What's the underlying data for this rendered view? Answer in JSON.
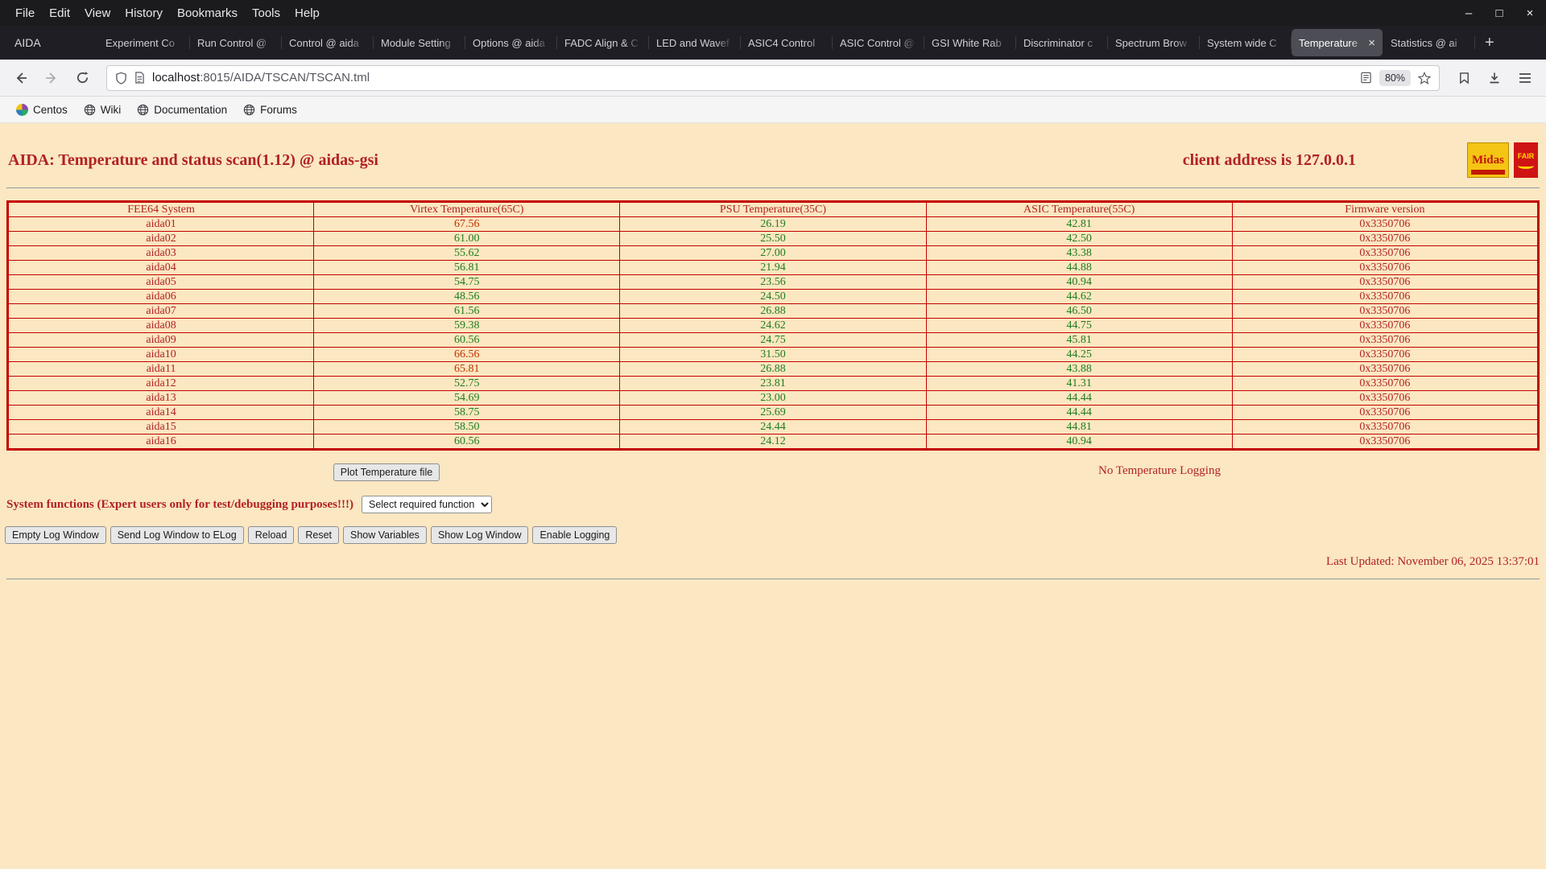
{
  "window": {
    "menu_items": [
      "File",
      "Edit",
      "View",
      "History",
      "Bookmarks",
      "Tools",
      "Help"
    ]
  },
  "tabs": {
    "app_label": "AIDA",
    "items": [
      {
        "label": "Experiment Co"
      },
      {
        "label": "Run Control @"
      },
      {
        "label": "Control @ aida"
      },
      {
        "label": "Module Setting"
      },
      {
        "label": "Options @ aida"
      },
      {
        "label": "FADC Align & C"
      },
      {
        "label": "LED and Wavef"
      },
      {
        "label": "ASIC4 Control"
      },
      {
        "label": "ASIC Control @"
      },
      {
        "label": "GSI White Rab"
      },
      {
        "label": "Discriminator c"
      },
      {
        "label": "Spectrum Brow"
      },
      {
        "label": "System wide C"
      },
      {
        "label": "Temperature",
        "active": true
      },
      {
        "label": "Statistics @ ai"
      }
    ]
  },
  "navbar": {
    "url_host": "localhost",
    "url_rest": ":8015/AIDA/TSCAN/TSCAN.tml",
    "zoom": "80%"
  },
  "bookmarks": [
    {
      "label": "Centos",
      "icon": "centos"
    },
    {
      "label": "Wiki",
      "icon": "globe"
    },
    {
      "label": "Documentation",
      "icon": "globe"
    },
    {
      "label": "Forums",
      "icon": "globe"
    }
  ],
  "page": {
    "title": "AIDA: Temperature and status scan(1.12) @ aidas-gsi",
    "client_address": "client address is 127.0.0.1",
    "logos": [
      {
        "name": "midas-logo",
        "text": "Midas"
      },
      {
        "name": "fair-logo",
        "text": "FAIR"
      }
    ],
    "table": {
      "headers": [
        "FEE64 System",
        "Virtex Temperature(65C)",
        "PSU Temperature(35C)",
        "ASIC Temperature(55C)",
        "Firmware version"
      ],
      "rows": [
        {
          "name": "aida01",
          "virtex": "67.56",
          "virtex_alarm": true,
          "psu": "26.19",
          "asic": "42.81",
          "fw": "0x3350706"
        },
        {
          "name": "aida02",
          "virtex": "61.00",
          "psu": "25.50",
          "asic": "42.50",
          "fw": "0x3350706"
        },
        {
          "name": "aida03",
          "virtex": "55.62",
          "psu": "27.00",
          "asic": "43.38",
          "fw": "0x3350706"
        },
        {
          "name": "aida04",
          "virtex": "56.81",
          "psu": "21.94",
          "asic": "44.88",
          "fw": "0x3350706"
        },
        {
          "name": "aida05",
          "virtex": "54.75",
          "psu": "23.56",
          "asic": "40.94",
          "fw": "0x3350706"
        },
        {
          "name": "aida06",
          "virtex": "48.56",
          "psu": "24.50",
          "asic": "44.62",
          "fw": "0x3350706"
        },
        {
          "name": "aida07",
          "virtex": "61.56",
          "psu": "26.88",
          "asic": "46.50",
          "fw": "0x3350706"
        },
        {
          "name": "aida08",
          "virtex": "59.38",
          "psu": "24.62",
          "asic": "44.75",
          "fw": "0x3350706"
        },
        {
          "name": "aida09",
          "virtex": "60.56",
          "psu": "24.75",
          "asic": "45.81",
          "fw": "0x3350706"
        },
        {
          "name": "aida10",
          "virtex": "66.56",
          "virtex_alarm": true,
          "psu": "31.50",
          "asic": "44.25",
          "fw": "0x3350706"
        },
        {
          "name": "aida11",
          "virtex": "65.81",
          "virtex_alarm": true,
          "psu": "26.88",
          "asic": "43.88",
          "fw": "0x3350706"
        },
        {
          "name": "aida12",
          "virtex": "52.75",
          "psu": "23.81",
          "asic": "41.31",
          "fw": "0x3350706"
        },
        {
          "name": "aida13",
          "virtex": "54.69",
          "psu": "23.00",
          "asic": "44.44",
          "fw": "0x3350706"
        },
        {
          "name": "aida14",
          "virtex": "58.75",
          "psu": "25.69",
          "asic": "44.44",
          "fw": "0x3350706"
        },
        {
          "name": "aida15",
          "virtex": "58.50",
          "psu": "24.44",
          "asic": "44.81",
          "fw": "0x3350706"
        },
        {
          "name": "aida16",
          "virtex": "60.56",
          "psu": "24.12",
          "asic": "40.94",
          "fw": "0x3350706"
        }
      ]
    },
    "plot_button": "Plot Temperature file",
    "logging_status": "No Temperature Logging",
    "system_functions_label": "System functions (Expert users only for test/debugging purposes!!!)",
    "select_placeholder": "Select required function",
    "action_buttons": [
      "Empty Log Window",
      "Send Log Window to ELog",
      "Reload",
      "Reset",
      "Show Variables",
      "Show Log Window",
      "Enable Logging"
    ],
    "last_updated": "Last Updated: November 06, 2025 13:37:01"
  }
}
